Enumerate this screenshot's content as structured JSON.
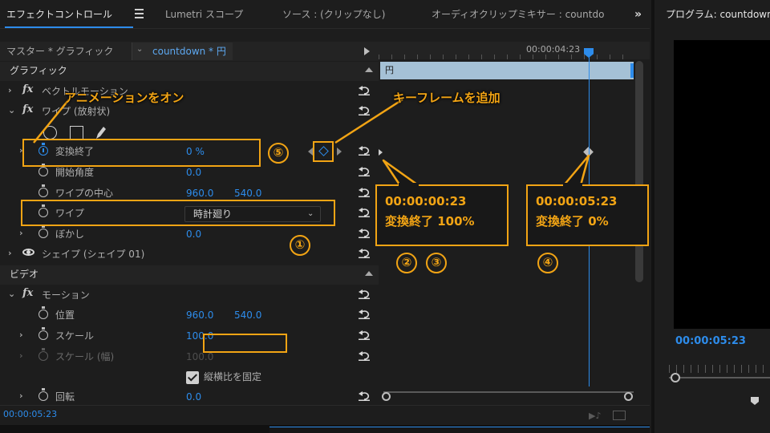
{
  "tabs": [
    {
      "label": "エフェクトコントロール"
    },
    {
      "label": "Lumetri スコープ"
    },
    {
      "label": "ソース : (クリップなし)"
    },
    {
      "label": "オーディオクリップミキサー : countdo"
    }
  ],
  "more_tabs_glyph": "»",
  "program": {
    "title": "プログラム: countdown",
    "timecode": "00:00:05:23"
  },
  "effect_controls": {
    "source_label": "マスター * グラフィック",
    "clip_label": "countdown * 円",
    "sections": {
      "graphics": "グラフィック",
      "video": "ビデオ"
    },
    "vector_motion": "ベクトルモーション",
    "wipe_effect": "ワイプ (放射状)",
    "props": {
      "transition_end": {
        "label": "変換終了",
        "value": "0 %"
      },
      "start_angle": {
        "label": "開始角度",
        "value": "0.0"
      },
      "wipe_center": {
        "label": "ワイプの中心",
        "x": "960.0",
        "y": "540.0"
      },
      "wipe": {
        "label": "ワイプ",
        "value": "時計廻り"
      },
      "feather": {
        "label": "ぼかし",
        "value": "0.0"
      }
    },
    "shape_group": "シェイプ (シェイプ 01)",
    "motion": {
      "label": "モーション",
      "position": {
        "label": "位置",
        "x": "960.0",
        "y": "540.0"
      },
      "scale": {
        "label": "スケール",
        "value": "100.0"
      },
      "scale_width": {
        "label": "スケール (幅)",
        "value": "100.0"
      },
      "uniform_scale": {
        "label": "縦横比を固定",
        "checked": true
      },
      "rotation": {
        "label": "回転",
        "value": "0.0"
      }
    },
    "footer_timecode": "00:00:05:23"
  },
  "timeline": {
    "ruler_time": "00:00:04:23",
    "clip_label": "円"
  },
  "annotations": {
    "animation_on": "アニメーションをオン",
    "add_keyframe": "キーフレームを追加",
    "callout1": {
      "time": "00:00:00:23",
      "text": "変換終了 100%"
    },
    "callout2": {
      "time": "00:00:05:23",
      "text": "変換終了 0%"
    },
    "numbers": [
      "①",
      "②",
      "③",
      "④",
      "⑤"
    ]
  },
  "colors": {
    "accent": "#2d8ceb",
    "annotation": "#f2a414",
    "clip": "#a5c1d6"
  }
}
